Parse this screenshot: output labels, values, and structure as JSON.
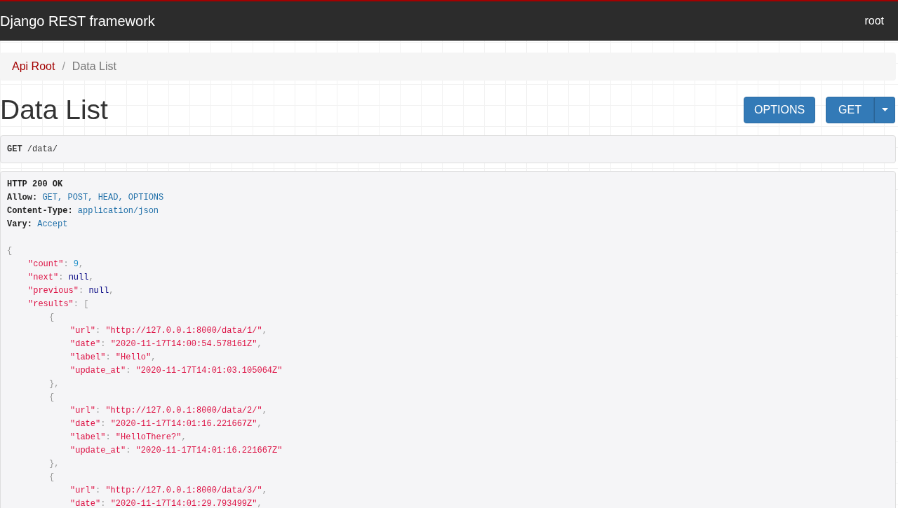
{
  "navbar": {
    "brand": "Django REST framework",
    "user": "root"
  },
  "breadcrumb": [
    {
      "label": "Api Root",
      "kind": "link"
    },
    {
      "label": "/",
      "kind": "separator"
    },
    {
      "label": "Data List",
      "kind": "current"
    }
  ],
  "page_title": "Data List",
  "buttons": [
    {
      "label": "OPTIONS",
      "kind": "plain"
    },
    {
      "label": "GET",
      "kind": "split"
    }
  ],
  "request": {
    "method": "GET",
    "path": "/data/"
  },
  "response_headers": [
    {
      "tokens": [
        {
          "kind": "status",
          "text": "HTTP 200 OK"
        }
      ]
    },
    {
      "tokens": [
        {
          "kind": "label",
          "text": "Allow:"
        },
        {
          "kind": "value",
          "text": " GET, POST, HEAD, OPTIONS"
        }
      ]
    },
    {
      "tokens": [
        {
          "kind": "label",
          "text": "Content-Type:"
        },
        {
          "kind": "value",
          "text": " application/json"
        }
      ]
    },
    {
      "tokens": [
        {
          "kind": "label",
          "text": "Vary:"
        },
        {
          "kind": "value",
          "text": " Accept"
        }
      ]
    }
  ],
  "response_body": [
    {
      "tokens": [
        {
          "kind": "punct",
          "text": "{"
        }
      ],
      "children": [
        {
          "tokens": [
            {
              "kind": "key",
              "text": "\"count\""
            },
            {
              "kind": "punct",
              "text": ": "
            },
            {
              "kind": "number",
              "text": "9"
            },
            {
              "kind": "punct",
              "text": ","
            }
          ]
        },
        {
          "tokens": [
            {
              "kind": "key",
              "text": "\"next\""
            },
            {
              "kind": "punct",
              "text": ": "
            },
            {
              "kind": "literal",
              "text": "null"
            },
            {
              "kind": "punct",
              "text": ","
            }
          ]
        },
        {
          "tokens": [
            {
              "kind": "key",
              "text": "\"previous\""
            },
            {
              "kind": "punct",
              "text": ": "
            },
            {
              "kind": "literal",
              "text": "null"
            },
            {
              "kind": "punct",
              "text": ","
            }
          ]
        },
        {
          "tokens": [
            {
              "kind": "key",
              "text": "\"results\""
            },
            {
              "kind": "punct",
              "text": ": ["
            }
          ],
          "children": [
            {
              "tokens": [
                {
                  "kind": "punct",
                  "text": "{"
                }
              ],
              "children": [
                {
                  "tokens": [
                    {
                      "kind": "key",
                      "text": "\"url\""
                    },
                    {
                      "kind": "punct",
                      "text": ": "
                    },
                    {
                      "kind": "string",
                      "text": "\"http://127.0.0.1:8000/data/1/\""
                    },
                    {
                      "kind": "punct",
                      "text": ","
                    }
                  ]
                },
                {
                  "tokens": [
                    {
                      "kind": "key",
                      "text": "\"date\""
                    },
                    {
                      "kind": "punct",
                      "text": ": "
                    },
                    {
                      "kind": "string",
                      "text": "\"2020-11-17T14:00:54.578161Z\""
                    },
                    {
                      "kind": "punct",
                      "text": ","
                    }
                  ]
                },
                {
                  "tokens": [
                    {
                      "kind": "key",
                      "text": "\"label\""
                    },
                    {
                      "kind": "punct",
                      "text": ": "
                    },
                    {
                      "kind": "string",
                      "text": "\"Hello\""
                    },
                    {
                      "kind": "punct",
                      "text": ","
                    }
                  ]
                },
                {
                  "tokens": [
                    {
                      "kind": "key",
                      "text": "\"update_at\""
                    },
                    {
                      "kind": "punct",
                      "text": ": "
                    },
                    {
                      "kind": "string",
                      "text": "\"2020-11-17T14:01:03.105064Z\""
                    }
                  ]
                }
              ]
            },
            {
              "tokens": [
                {
                  "kind": "punct",
                  "text": "},"
                }
              ]
            },
            {
              "tokens": [
                {
                  "kind": "punct",
                  "text": "{"
                }
              ],
              "children": [
                {
                  "tokens": [
                    {
                      "kind": "key",
                      "text": "\"url\""
                    },
                    {
                      "kind": "punct",
                      "text": ": "
                    },
                    {
                      "kind": "string",
                      "text": "\"http://127.0.0.1:8000/data/2/\""
                    },
                    {
                      "kind": "punct",
                      "text": ","
                    }
                  ]
                },
                {
                  "tokens": [
                    {
                      "kind": "key",
                      "text": "\"date\""
                    },
                    {
                      "kind": "punct",
                      "text": ": "
                    },
                    {
                      "kind": "string",
                      "text": "\"2020-11-17T14:01:16.221667Z\""
                    },
                    {
                      "kind": "punct",
                      "text": ","
                    }
                  ]
                },
                {
                  "tokens": [
                    {
                      "kind": "key",
                      "text": "\"label\""
                    },
                    {
                      "kind": "punct",
                      "text": ": "
                    },
                    {
                      "kind": "string",
                      "text": "\"HelloThere?\""
                    },
                    {
                      "kind": "punct",
                      "text": ","
                    }
                  ]
                },
                {
                  "tokens": [
                    {
                      "kind": "key",
                      "text": "\"update_at\""
                    },
                    {
                      "kind": "punct",
                      "text": ": "
                    },
                    {
                      "kind": "string",
                      "text": "\"2020-11-17T14:01:16.221667Z\""
                    }
                  ]
                }
              ]
            },
            {
              "tokens": [
                {
                  "kind": "punct",
                  "text": "},"
                }
              ]
            },
            {
              "tokens": [
                {
                  "kind": "punct",
                  "text": "{"
                }
              ],
              "children": [
                {
                  "tokens": [
                    {
                      "kind": "key",
                      "text": "\"url\""
                    },
                    {
                      "kind": "punct",
                      "text": ": "
                    },
                    {
                      "kind": "string",
                      "text": "\"http://127.0.0.1:8000/data/3/\""
                    },
                    {
                      "kind": "punct",
                      "text": ","
                    }
                  ]
                },
                {
                  "tokens": [
                    {
                      "kind": "key",
                      "text": "\"date\""
                    },
                    {
                      "kind": "punct",
                      "text": ": "
                    },
                    {
                      "kind": "string",
                      "text": "\"2020-11-17T14:01:29.793499Z\""
                    },
                    {
                      "kind": "punct",
                      "text": ","
                    }
                  ]
                }
              ]
            }
          ]
        }
      ]
    }
  ]
}
